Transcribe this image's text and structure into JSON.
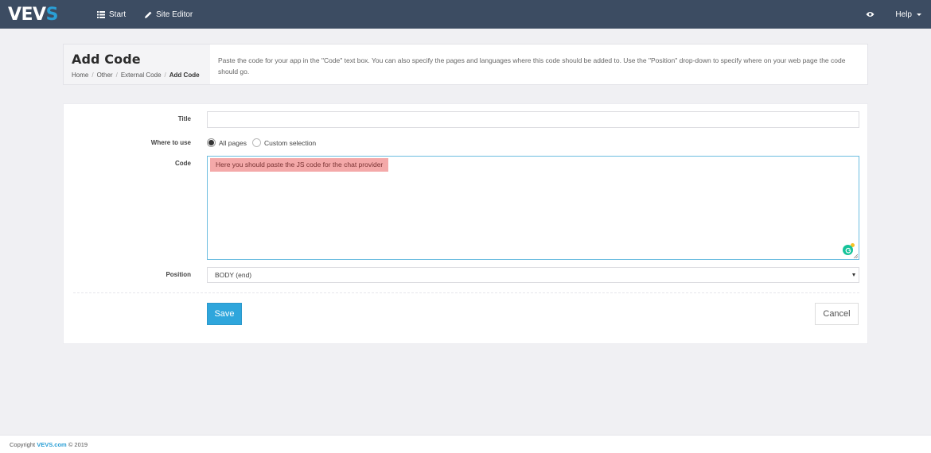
{
  "topbar": {
    "logo_main": "VEV",
    "logo_accent": "S",
    "start_label": "Start",
    "site_editor_label": "Site Editor",
    "help_label": "Help"
  },
  "header": {
    "title": "Add Code",
    "breadcrumb": [
      "Home",
      "Other",
      "External Code",
      "Add Code"
    ],
    "description": "Paste the code for your app in the \"Code\" text box. You can also specify the pages and languages where this code should be added to. Use the \"Position\" drop-down to specify where on your web page the code should go."
  },
  "form": {
    "title_label": "Title",
    "title_value": "",
    "where_label": "Where to use",
    "where_options": [
      "All pages",
      "Custom selection"
    ],
    "where_selected": "All pages",
    "code_label": "Code",
    "code_value": "Here you should paste the JS code for the chat provider",
    "position_label": "Position",
    "position_value": "BODY (end)",
    "save_label": "Save",
    "cancel_label": "Cancel"
  },
  "footer": {
    "prefix": "Copyright",
    "brand": "VEVS.com",
    "suffix": "© 2019"
  },
  "colors": {
    "topbar": "#3c4c62",
    "accent": "#2fa6dc",
    "code_highlight": "#f4a9a9"
  },
  "icons": [
    "list-icon",
    "pencil-icon",
    "eye-icon",
    "grammarly-icon"
  ]
}
